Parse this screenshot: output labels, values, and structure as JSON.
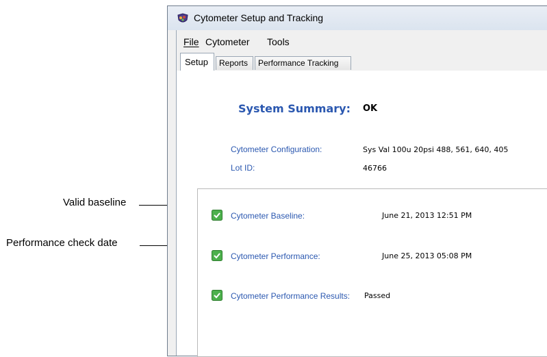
{
  "callouts": {
    "baseline": "Valid baseline",
    "performance_date": "Performance check date"
  },
  "window": {
    "title": "Cytometer Setup and Tracking"
  },
  "menu": {
    "file": "File",
    "cytometer": "Cytometer",
    "tools": "Tools"
  },
  "tabs": [
    {
      "label": "Setup",
      "active": true
    },
    {
      "label": "Reports",
      "active": false
    },
    {
      "label": "Performance Tracking",
      "active": false
    }
  ],
  "summary": {
    "label": "System Summary:",
    "status": "OK"
  },
  "config": {
    "configuration_label": "Cytometer Configuration:",
    "configuration_value": "Sys Val 100u 20psi 488, 561, 640, 405",
    "lot_label": "Lot ID:",
    "lot_value": "46766"
  },
  "status_rows": [
    {
      "label": "Cytometer Baseline:",
      "value": "June 21, 2013 12:51 PM",
      "icon": "green-check-icon"
    },
    {
      "label": "Cytometer Performance:",
      "value": "June 25, 2013 05:08 PM",
      "icon": "green-check-icon"
    },
    {
      "label": "Cytometer Performance Results:",
      "value": "Passed",
      "icon": "green-check-icon"
    }
  ],
  "colors": {
    "label_blue": "#2b58b0",
    "check_green": "#3fa63f"
  }
}
